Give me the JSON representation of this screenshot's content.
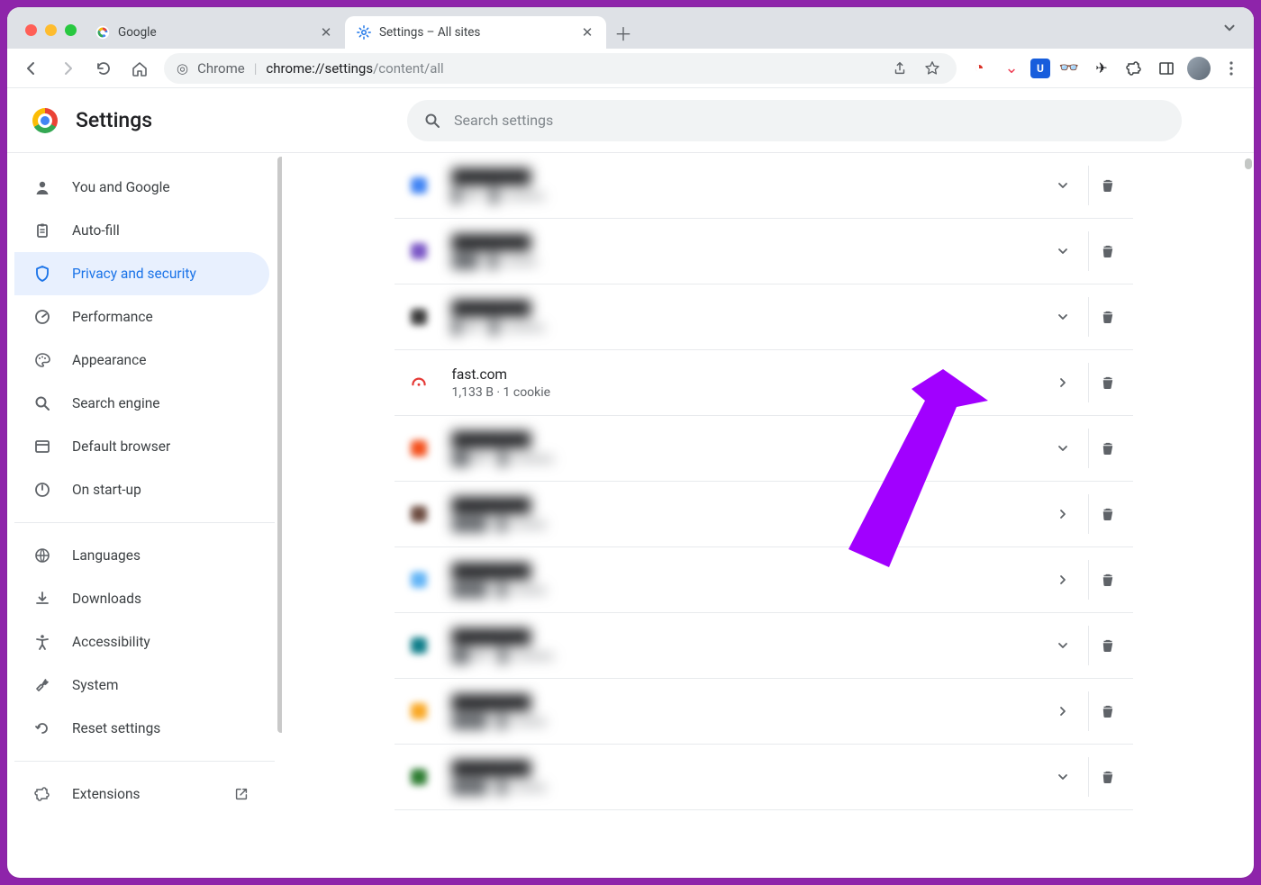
{
  "tabs": [
    {
      "title": "Google",
      "favicon": "google"
    },
    {
      "title": "Settings – All sites",
      "favicon": "gear",
      "active": true
    }
  ],
  "omnibox": {
    "scheme_label": "Chrome",
    "url_bold": "chrome://settings",
    "url_rest": "/content/all"
  },
  "header": {
    "title": "Settings",
    "search_placeholder": "Search settings"
  },
  "sidebar": {
    "items": [
      {
        "icon": "person",
        "label": "You and Google"
      },
      {
        "icon": "clipboard",
        "label": "Auto-fill"
      },
      {
        "icon": "shield",
        "label": "Privacy and security",
        "active": true
      },
      {
        "icon": "gauge",
        "label": "Performance"
      },
      {
        "icon": "palette",
        "label": "Appearance"
      },
      {
        "icon": "search",
        "label": "Search engine"
      },
      {
        "icon": "browser",
        "label": "Default browser"
      },
      {
        "icon": "power",
        "label": "On start-up"
      }
    ],
    "items2": [
      {
        "icon": "globe",
        "label": "Languages"
      },
      {
        "icon": "download",
        "label": "Downloads"
      },
      {
        "icon": "accessibility",
        "label": "Accessibility"
      },
      {
        "icon": "wrench",
        "label": "System"
      },
      {
        "icon": "reset",
        "label": "Reset settings"
      }
    ],
    "extensions_label": "Extensions"
  },
  "sites": [
    {
      "blurred": true,
      "iconColor": "#4285f4",
      "title": "████████",
      "sub": "█ KB · █ cookies",
      "chev": "down"
    },
    {
      "blurred": true,
      "iconColor": "#7b57c6",
      "title": "████████",
      "sub": "███ · █ cookie",
      "chev": "down"
    },
    {
      "blurred": true,
      "iconColor": "#3c3c3c",
      "title": "████████",
      "sub": "█ KB · █ cookies",
      "chev": "down"
    },
    {
      "blurred": false,
      "iconColor": "#e53935",
      "iconSvg": "fast",
      "title": "fast.com",
      "sub": "1,133 B · 1 cookie",
      "chev": "right"
    },
    {
      "blurred": true,
      "iconColor": "#f4511e",
      "title": "████████",
      "sub": "██ KB · █ cookies",
      "chev": "down"
    },
    {
      "blurred": true,
      "iconColor": "#6d4c41",
      "title": "████████",
      "sub": "████ · █ cookie",
      "chev": "right"
    },
    {
      "blurred": true,
      "iconColor": "#64b5f6",
      "title": "████████",
      "sub": "████ · █ cookie",
      "chev": "right"
    },
    {
      "blurred": true,
      "iconColor": "#0f7e8a",
      "title": "████████",
      "sub": "██ KB · █ cookies",
      "chev": "down"
    },
    {
      "blurred": true,
      "iconColor": "#f9a825",
      "title": "████████",
      "sub": "████ · █ cookie",
      "chev": "right"
    },
    {
      "blurred": true,
      "iconColor": "#2e7d32",
      "title": "████████",
      "sub": "████ · █ cookie",
      "chev": "down"
    }
  ],
  "annotation": {
    "color": "#a100ff"
  }
}
